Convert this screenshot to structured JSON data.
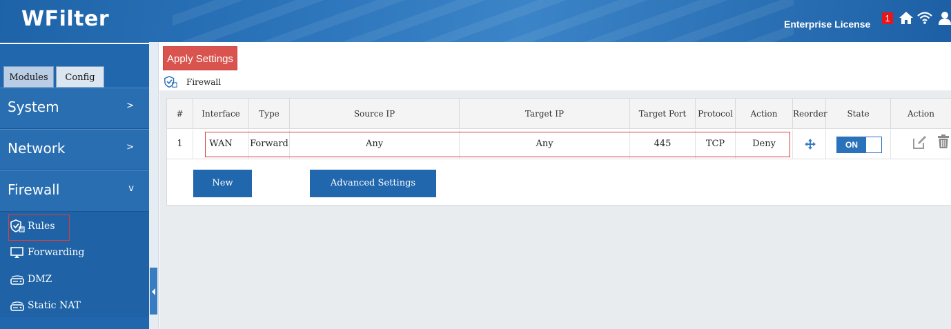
{
  "header": {
    "brand": "WFilter",
    "license": "Enterprise License",
    "notification_count": "1",
    "icons": [
      "home-icon",
      "wifi-icon",
      "user-icon"
    ]
  },
  "sidebar": {
    "tabs": [
      {
        "label": "Modules"
      },
      {
        "label": "Config"
      }
    ],
    "menus": [
      {
        "label": "System",
        "chevron": ">"
      },
      {
        "label": "Network",
        "chevron": ">"
      },
      {
        "label": "Firewall",
        "chevron": "v"
      }
    ],
    "submenu": [
      {
        "label": "Rules",
        "icon": "shield-check-icon",
        "selected": true
      },
      {
        "label": "Forwarding",
        "icon": "monitor-icon"
      },
      {
        "label": "DMZ",
        "icon": "router-icon"
      },
      {
        "label": "Static NAT",
        "icon": "router-icon"
      }
    ]
  },
  "toolbar": {
    "apply_label": "Apply Settings"
  },
  "breadcrumb": {
    "label": "Firewall"
  },
  "table": {
    "columns": [
      "#",
      "Interface",
      "Type",
      "Source IP",
      "Target IP",
      "Target Port",
      "Protocol",
      "Action",
      "Reorder",
      "State",
      "Action"
    ],
    "rows": [
      {
        "num": "1",
        "interface": "WAN",
        "type": "Forward",
        "source_ip": "Any",
        "target_ip": "Any",
        "target_port": "445",
        "protocol": "TCP",
        "action": "Deny",
        "state": "ON"
      }
    ]
  },
  "buttons": {
    "new_label": "New",
    "advanced_label": "Advanced Settings"
  },
  "colors": {
    "accent": "#2167ad",
    "danger": "#d9534f",
    "highlight": "#d43c3c"
  }
}
